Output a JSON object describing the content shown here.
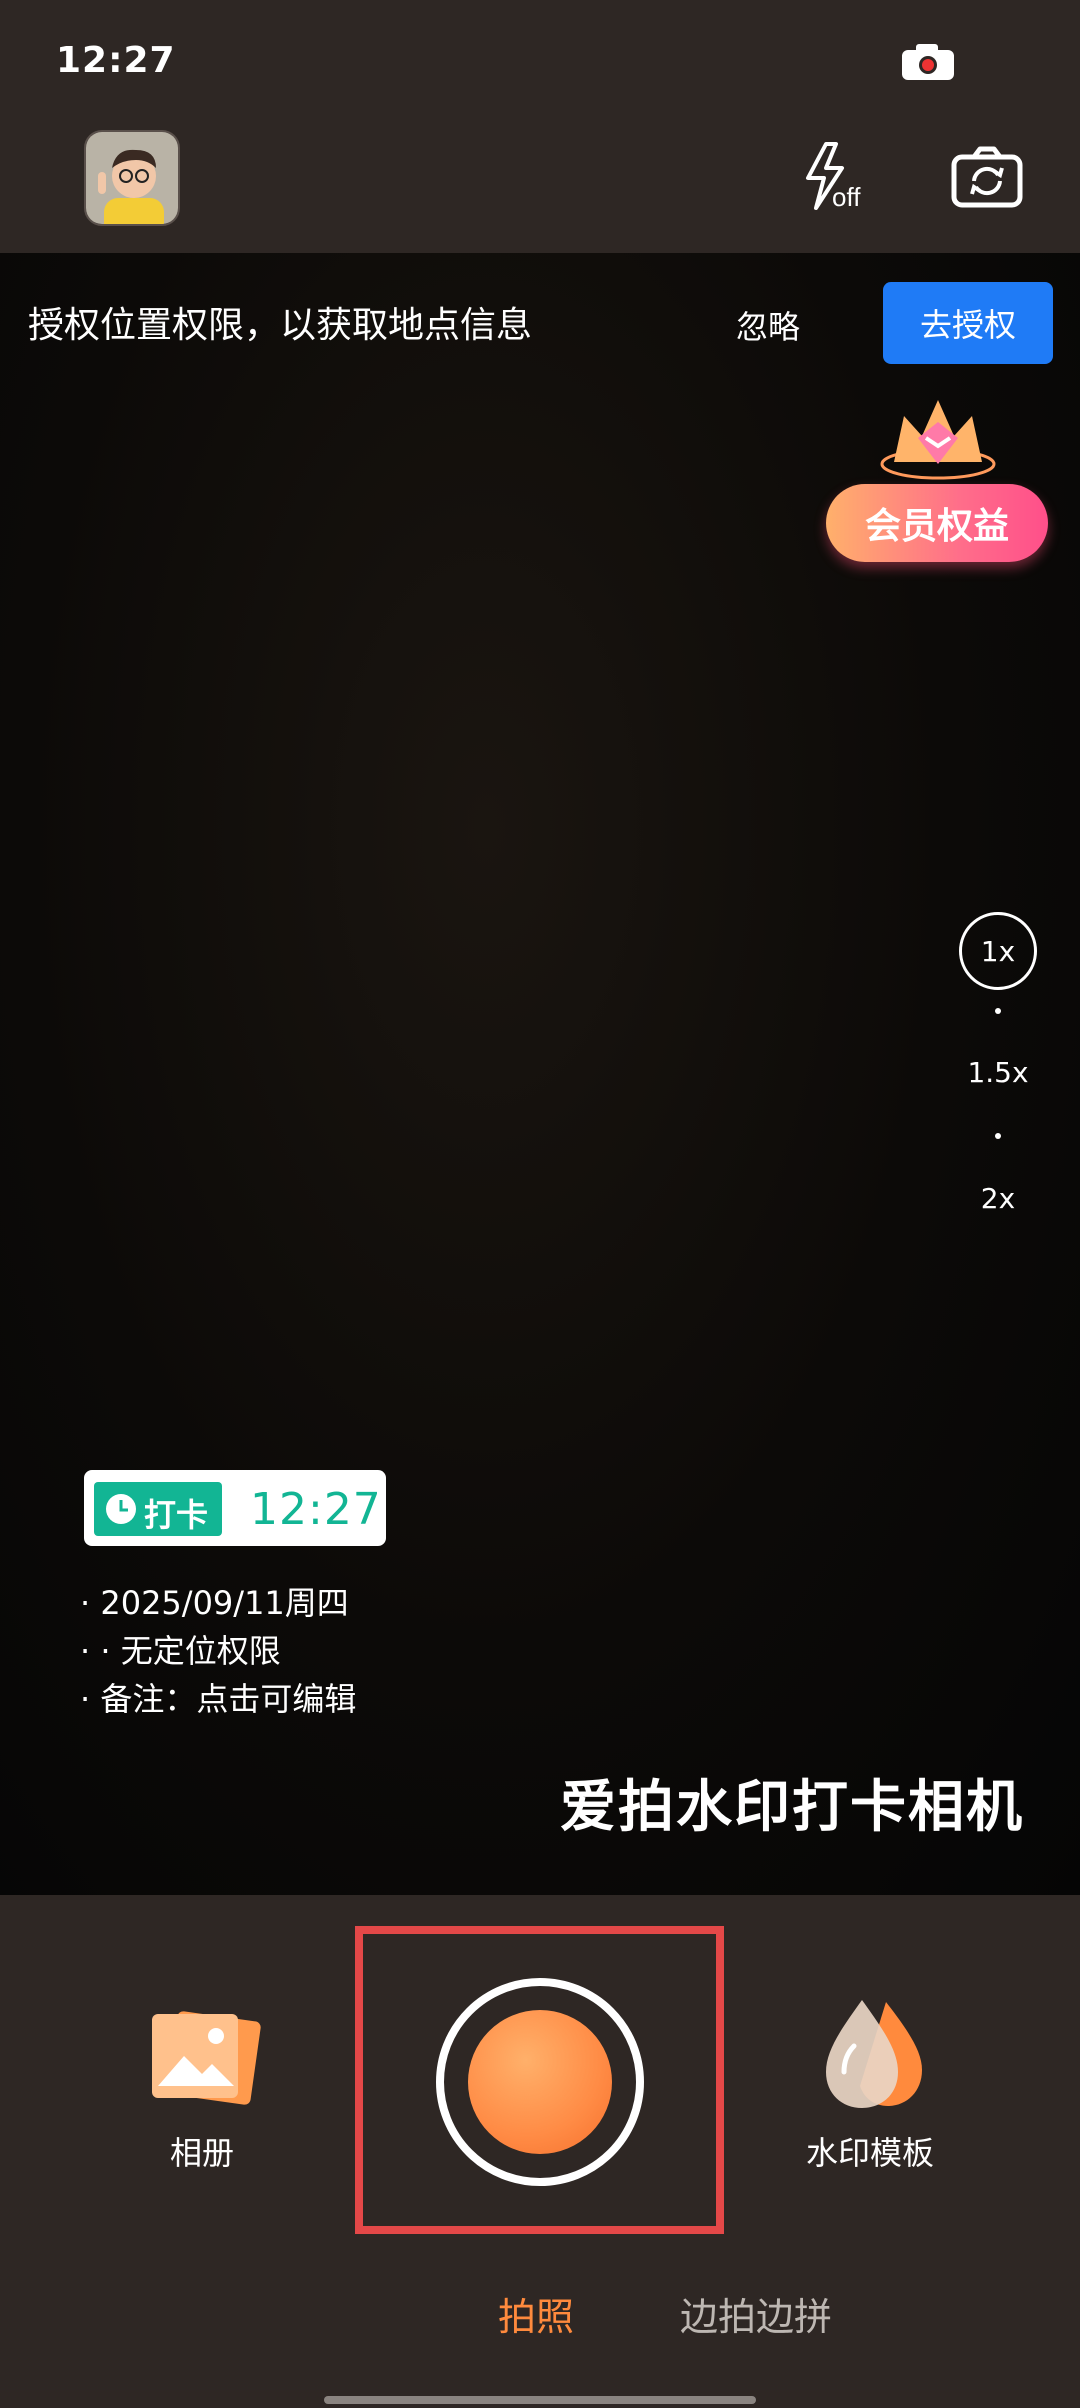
{
  "status": {
    "time": "12:27"
  },
  "top_controls": {
    "flash_state": "off"
  },
  "permission_bar": {
    "message": "授权位置权限，以获取地点信息",
    "ignore_label": "忽略",
    "authorize_label": "去授权",
    "authorize_color": "#1f7bf6"
  },
  "vip": {
    "label": "会员权益"
  },
  "zoom": {
    "levels": [
      "1x",
      "1.5x",
      "2x"
    ],
    "selected": "1x"
  },
  "watermark": {
    "tag": "打卡",
    "time": "12:27",
    "lines": [
      "· 2025/09/11周四",
      "·   · 无定位权限",
      "· 备注：点击可编辑"
    ],
    "accent": "#12b594"
  },
  "brand_text": "爱拍水印打卡相机",
  "bottom": {
    "album_label": "相册",
    "template_label": "水印模板",
    "modes": [
      "拍照",
      "边拍边拼"
    ],
    "active_mode": "拍照",
    "accent": "#ff8a3d"
  },
  "icons": [
    "camera-status-icon",
    "avatar",
    "flash-off-icon",
    "switch-camera-icon",
    "clock-icon",
    "album-icon",
    "watermark-template-icon",
    "diamond-crown-icon"
  ]
}
